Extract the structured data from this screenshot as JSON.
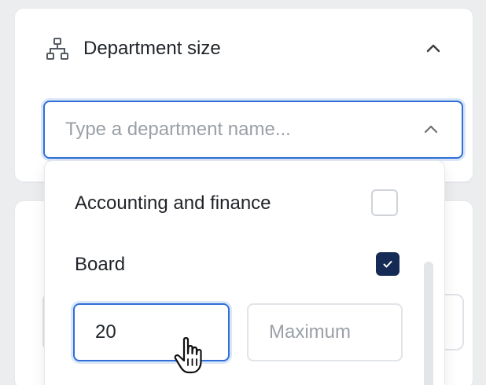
{
  "header": {
    "title": "Department size",
    "icon": "org-chart-icon",
    "toggle_icon": "chevron-up-icon"
  },
  "search": {
    "placeholder": "Type a department name...",
    "value": ""
  },
  "options": [
    {
      "label": "Accounting and finance",
      "checked": false
    },
    {
      "label": "Board",
      "checked": true
    }
  ],
  "range": {
    "min_value": "20",
    "max_placeholder": "Maximum",
    "max_value": ""
  },
  "colors": {
    "accent": "#2f6fd6",
    "checked_box": "#152a55",
    "text": "#1f2328",
    "placeholder": "#9aa0a6"
  }
}
